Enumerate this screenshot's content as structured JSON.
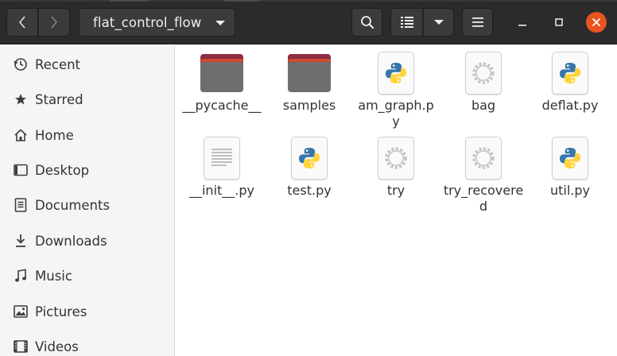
{
  "header": {
    "path_label": "flat_control_flow",
    "icons": {
      "back": "chevron-left-icon",
      "forward": "chevron-right-icon",
      "search": "search-icon",
      "view": "list-view-icon",
      "view_options": "chevron-down-icon",
      "menu": "hamburger-menu-icon",
      "minimize": "minimize-icon",
      "maximize": "maximize-icon",
      "close": "close-icon"
    },
    "colors": {
      "headerbar": "#2b2b2b",
      "close_button": "#e95420"
    }
  },
  "sidebar": {
    "items": [
      {
        "label": "Recent",
        "icon": "clock-icon"
      },
      {
        "label": "Starred",
        "icon": "star-icon"
      },
      {
        "label": "Home",
        "icon": "home-icon"
      },
      {
        "label": "Desktop",
        "icon": "desktop-icon"
      },
      {
        "label": "Documents",
        "icon": "documents-icon"
      },
      {
        "label": "Downloads",
        "icon": "download-icon"
      },
      {
        "label": "Music",
        "icon": "music-icon"
      },
      {
        "label": "Pictures",
        "icon": "pictures-icon"
      },
      {
        "label": "Videos",
        "icon": "videos-icon"
      }
    ]
  },
  "files": [
    {
      "name": "__pycache__",
      "type": "folder"
    },
    {
      "name": "samples",
      "type": "folder"
    },
    {
      "name": "am_graph.py",
      "type": "python"
    },
    {
      "name": "bag",
      "type": "executable"
    },
    {
      "name": "deflat.py",
      "type": "python"
    },
    {
      "name": "__init__.py",
      "type": "text"
    },
    {
      "name": "test.py",
      "type": "python"
    },
    {
      "name": "try",
      "type": "executable"
    },
    {
      "name": "try_recovered",
      "type": "executable"
    },
    {
      "name": "util.py",
      "type": "python"
    }
  ]
}
